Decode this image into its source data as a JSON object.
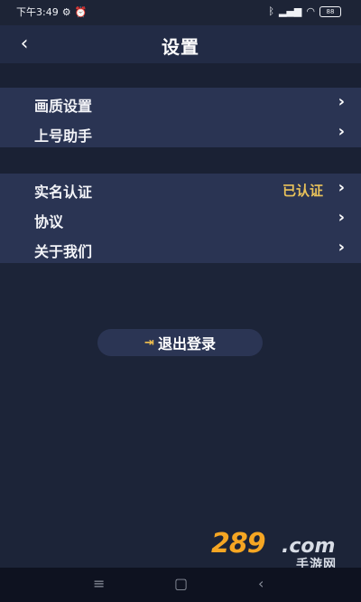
{
  "status_bar": {
    "time": "下午3:49",
    "icons_left": [
      "settings-icon",
      "alarm-icon"
    ],
    "icons_right": [
      "bluetooth-icon",
      "signal-icon",
      "wifi-icon",
      "battery-icon"
    ],
    "battery": "88"
  },
  "header": {
    "back_icon": "back-icon",
    "title": "设置"
  },
  "groups": [
    {
      "items": [
        {
          "label": "画质设置",
          "value": ""
        },
        {
          "label": "上号助手",
          "value": ""
        }
      ]
    },
    {
      "items": [
        {
          "label": "实名认证",
          "value": "已认证"
        },
        {
          "label": "协议",
          "value": ""
        },
        {
          "label": "关于我们",
          "value": ""
        }
      ]
    }
  ],
  "logout": {
    "label": "退出登录",
    "icon": "logout-icon"
  },
  "watermark": {
    "brand": "289",
    "domain": ".com",
    "cn": "手游网"
  },
  "system_nav": [
    "menu-icon",
    "home-icon",
    "back-icon"
  ],
  "colors": {
    "background": "#1c2438",
    "row_background": "#2a3453",
    "accent": "#e9c25a"
  }
}
